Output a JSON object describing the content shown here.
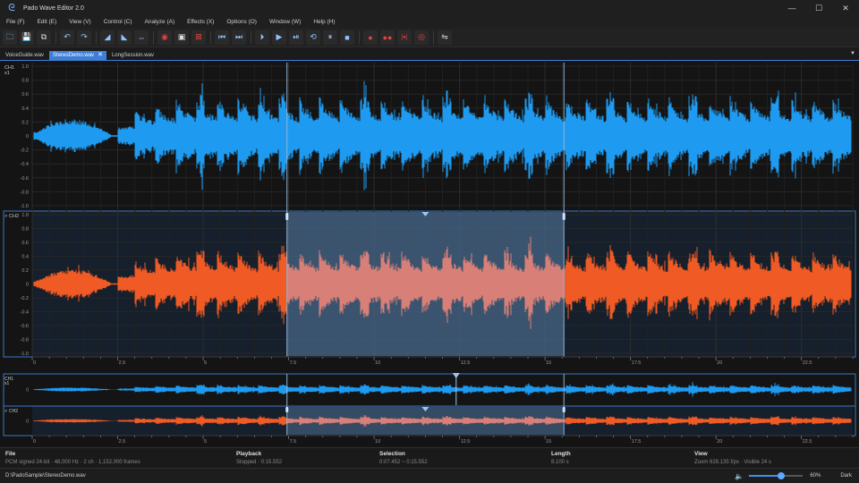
{
  "window": {
    "title": "Pado Wave Editor 2.0",
    "minimize": "—",
    "maximize": "☐",
    "close": "✕"
  },
  "menu": [
    "File (F)",
    "Edit (E)",
    "View (V)",
    "Control (C)",
    "Analyze (A)",
    "Effects (X)",
    "Options (O)",
    "Window (W)",
    "Help (H)"
  ],
  "toolbar": {
    "groups": [
      [
        {
          "name": "open-icon",
          "glyph": "🗀",
          "tone": "blue"
        },
        {
          "name": "save-icon",
          "glyph": "💾",
          "tone": "white"
        },
        {
          "name": "save-all-icon",
          "glyph": "⧉",
          "tone": "white"
        }
      ],
      [
        {
          "name": "undo-icon",
          "glyph": "↶",
          "tone": "blue"
        },
        {
          "name": "redo-icon",
          "glyph": "↷",
          "tone": "blue"
        }
      ],
      [
        {
          "name": "fade-in-icon",
          "glyph": "◢",
          "tone": "blue"
        },
        {
          "name": "fade-out-icon",
          "glyph": "◣",
          "tone": "blue"
        },
        {
          "name": "normalize-icon",
          "glyph": "⇔",
          "tone": "blue"
        }
      ],
      [
        {
          "name": "marker-set-icon",
          "glyph": "◉",
          "tone": "red"
        },
        {
          "name": "marker-range-icon",
          "glyph": "▣",
          "tone": "white"
        },
        {
          "name": "marker-clear-icon",
          "glyph": "⊠",
          "tone": "red"
        }
      ],
      [
        {
          "name": "go-start-icon",
          "glyph": "⏮",
          "tone": "blue"
        },
        {
          "name": "go-end-icon",
          "glyph": "⏭",
          "tone": "blue"
        }
      ],
      [
        {
          "name": "play-from-start-icon",
          "glyph": "⏵",
          "tone": "blue"
        },
        {
          "name": "play-icon",
          "glyph": "▶",
          "tone": "blue"
        },
        {
          "name": "play-selection-icon",
          "glyph": "⏯",
          "tone": "blue"
        },
        {
          "name": "loop-icon",
          "glyph": "⟲",
          "tone": "blue"
        },
        {
          "name": "pause-icon",
          "glyph": "⏸",
          "tone": "blue"
        },
        {
          "name": "stop-icon",
          "glyph": "■",
          "tone": "blue"
        }
      ],
      [
        {
          "name": "record-icon",
          "glyph": "●",
          "tone": "red"
        },
        {
          "name": "record-append-icon",
          "glyph": "●●",
          "tone": "red"
        },
        {
          "name": "record-selection-icon",
          "glyph": "[●]",
          "tone": "red"
        },
        {
          "name": "record-punch-icon",
          "glyph": "◎",
          "tone": "red"
        }
      ],
      [
        {
          "name": "monitor-icon",
          "glyph": "⇋",
          "tone": "white"
        }
      ]
    ]
  },
  "tabs": [
    {
      "label": "VoiceGuide.wav",
      "active": false
    },
    {
      "label": "StereoDemo.wav",
      "active": true
    },
    {
      "label": "LongSession.wav",
      "active": false
    }
  ],
  "tab_close": "✕",
  "tab_menu": "▼",
  "channels": {
    "ch1": {
      "label": "CH1",
      "scale": "x1",
      "color": "#1e9bf0"
    },
    "ch2": {
      "label": "CH2",
      "marker": ">",
      "color": "#f05a24",
      "selected_color": "#d88078"
    }
  },
  "amplitude_ticks": [
    "1.0",
    "0.8",
    "0.6",
    "0.4",
    "0.2",
    "0",
    "-0.2",
    "-0.4",
    "-0.6",
    "-0.8",
    "-1.0"
  ],
  "time_ticks": [
    {
      "t": 0,
      "label": "0"
    },
    {
      "t": 2.5,
      "label": "2.5"
    },
    {
      "t": 5,
      "label": "5"
    },
    {
      "t": 7.5,
      "label": "7.5"
    },
    {
      "t": 10,
      "label": "10"
    },
    {
      "t": 12.5,
      "label": "12.5"
    },
    {
      "t": 15,
      "label": "15"
    },
    {
      "t": 17.5,
      "label": "17.5"
    },
    {
      "t": 20,
      "label": "20"
    },
    {
      "t": 22.5,
      "label": "22.5"
    }
  ],
  "overview": {
    "ch1": {
      "label": "CH1",
      "scale": "x1",
      "zero": "0"
    },
    "ch2": {
      "label": "CH2",
      "marker": ">",
      "zero": "0"
    }
  },
  "timeline": {
    "duration_s": 24,
    "selection_start_s": 7.452,
    "selection_end_s": 15.552,
    "playhead_s": 7.452,
    "view_cursor_s": 11.5
  },
  "info": {
    "file": {
      "title": "File",
      "value": "PCM signed 24-bit · 48,000 Hz · 2 ch · 1,152,000 frames"
    },
    "playback": {
      "title": "Playback",
      "value": "Stopped · 0:15.552"
    },
    "selection": {
      "title": "Selection",
      "value": "0:07.452 ~ 0:15.552"
    },
    "length": {
      "title": "Length",
      "value": "8.100 s"
    },
    "view": {
      "title": "View",
      "value": "Zoom 628.135 f/px · Visible 24 s"
    }
  },
  "status": {
    "path": "D:\\PadoSample\\StereoDemo.wav",
    "speaker": "🔈",
    "zoom_value": 0.6,
    "zoom_label": "60%",
    "theme": "Dark"
  }
}
